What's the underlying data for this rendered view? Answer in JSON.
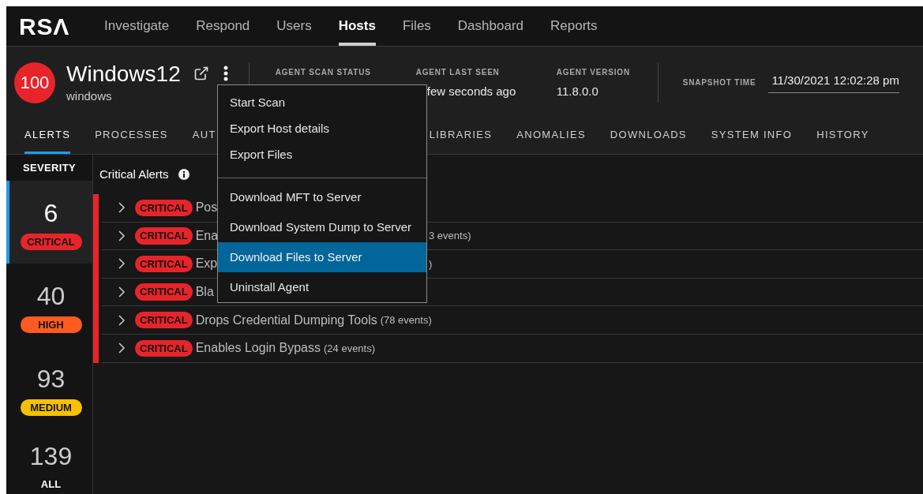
{
  "nav": {
    "logo": "RSΛ",
    "items": [
      {
        "label": "Investigate",
        "selected": false
      },
      {
        "label": "Respond",
        "selected": false
      },
      {
        "label": "Users",
        "selected": false
      },
      {
        "label": "Hosts",
        "selected": true
      },
      {
        "label": "Files",
        "selected": false
      },
      {
        "label": "Dashboard",
        "selected": false
      },
      {
        "label": "Reports",
        "selected": false
      }
    ]
  },
  "host": {
    "score": "100",
    "name": "Windows12",
    "os": "windows",
    "fields": [
      {
        "label": "AGENT SCAN STATUS"
      },
      {
        "label": "AGENT LAST SEEN",
        "value": "few seconds ago"
      },
      {
        "label": "AGENT VERSION",
        "value": "11.8.0.0"
      }
    ],
    "snapshot": {
      "label": "SNAPSHOT TIME",
      "value": "11/30/2021 12:02:28 pm"
    }
  },
  "tabs": [
    {
      "label": "ALERTS",
      "selected": true
    },
    {
      "label": "PROCESSES",
      "selected": false
    },
    {
      "label": "AUT",
      "selected": false
    },
    {
      "label": "LIBRARIES",
      "selected": false
    },
    {
      "label": "ANOMALIES",
      "selected": false
    },
    {
      "label": "DOWNLOADS",
      "selected": false
    },
    {
      "label": "SYSTEM INFO",
      "selected": false
    },
    {
      "label": "HISTORY",
      "selected": false
    }
  ],
  "severity": {
    "title": "SEVERITY",
    "items": [
      {
        "count": "6",
        "label": "CRITICAL",
        "color": "#e8242b",
        "selected": true
      },
      {
        "count": "40",
        "label": "HIGH",
        "color": "#ff5a1f",
        "selected": false
      },
      {
        "count": "93",
        "label": "MEDIUM",
        "color": "#f7c000",
        "selected": false
      },
      {
        "count": "139",
        "label": "ALL",
        "selected": false
      }
    ]
  },
  "alerts": {
    "title": "Critical Alerts",
    "rows": [
      {
        "badge": "CRITICAL",
        "title": "Pos"
      },
      {
        "badge": "CRITICAL",
        "title": "Ena",
        "tail": "3 events)"
      },
      {
        "badge": "CRITICAL",
        "title": "Exp",
        "tail": ")"
      },
      {
        "badge": "CRITICAL",
        "title": "Bla"
      },
      {
        "badge": "CRITICAL",
        "title": "Drops Credential Dumping Tools",
        "count": "(78 events)"
      },
      {
        "badge": "CRITICAL",
        "title": "Enables Login Bypass",
        "count": "(24 events)"
      }
    ]
  },
  "menu": {
    "groups": [
      [
        {
          "label": "Start Scan",
          "selected": false
        },
        {
          "label": "Export Host details",
          "selected": false
        },
        {
          "label": "Export Files",
          "selected": false
        }
      ],
      [
        {
          "label": "Download MFT to Server",
          "selected": false
        },
        {
          "label": "Download System Dump to Server",
          "selected": false
        },
        {
          "label": "Download Files to Server",
          "selected": true
        },
        {
          "label": "Uninstall Agent",
          "selected": false
        }
      ]
    ]
  }
}
